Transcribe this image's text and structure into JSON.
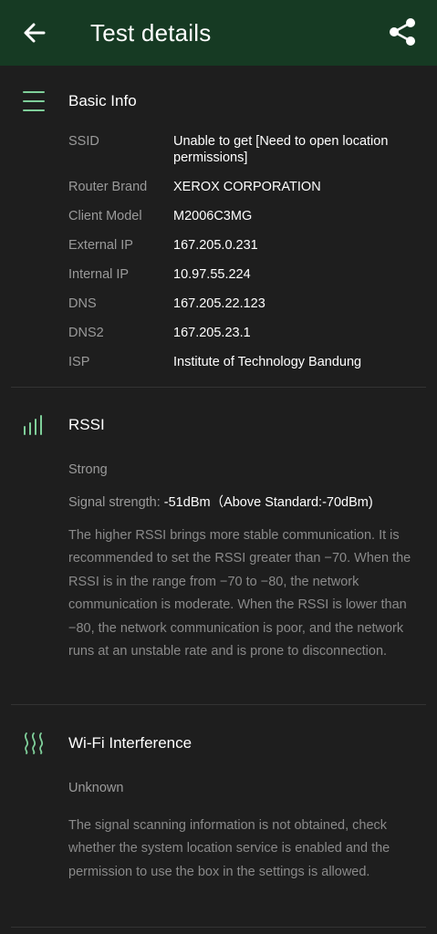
{
  "header": {
    "title": "Test details"
  },
  "basic_info": {
    "title": "Basic Info",
    "rows": [
      {
        "key": "SSID",
        "value": "Unable to get [Need to open location permissions]"
      },
      {
        "key": "Router Brand",
        "value": "XEROX CORPORATION"
      },
      {
        "key": "Client Model",
        "value": "M2006C3MG"
      },
      {
        "key": "External IP",
        "value": "167.205.0.231"
      },
      {
        "key": "Internal IP",
        "value": "10.97.55.224"
      },
      {
        "key": "DNS",
        "value": "167.205.22.123"
      },
      {
        "key": "DNS2",
        "value": "167.205.23.1"
      },
      {
        "key": "ISP",
        "value": "Institute of Technology Bandung"
      }
    ]
  },
  "rssi": {
    "title": "RSSI",
    "status": "Strong",
    "strength_label": "Signal strength:",
    "strength_value": " -51dBm（Above Standard:-70dBm)",
    "description": "The higher RSSI brings more stable communication. It is recommended to set the RSSI greater than −70. When the RSSI is in the range from −70 to −80, the network communication is moderate. When the RSSI is lower than −80, the network communication is poor, and the network runs at an unstable rate and is prone to disconnection."
  },
  "interference": {
    "title": "Wi-Fi Interference",
    "status": "Unknown",
    "description": "The signal scanning information is not obtained, check whether the system location service is enabled and the permission to use the box in the settings is allowed."
  },
  "colors": {
    "appbar": "#163a23",
    "background": "#1e1e1e",
    "accent_icon": "#7fcf9a"
  },
  "icons": {
    "back": "back-arrow-icon",
    "share": "share-icon",
    "basic_info": "menu-lines-icon",
    "rssi": "signal-bars-icon",
    "interference": "wave-lines-icon"
  }
}
